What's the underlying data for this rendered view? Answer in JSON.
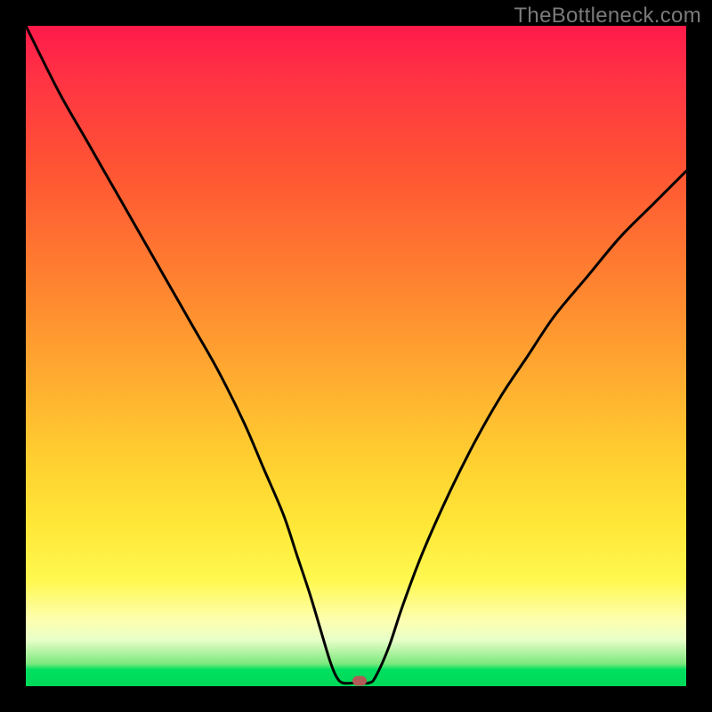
{
  "watermark": "TheBottleneck.com",
  "colors": {
    "frame": "#000000",
    "curve": "#000000",
    "marker": "#b25a55"
  },
  "chart_data": {
    "type": "line",
    "title": "",
    "xlabel": "",
    "ylabel": "",
    "xlim": [
      0,
      100
    ],
    "ylim": [
      0,
      100
    ],
    "grid": false,
    "watermark": "TheBottleneck.com",
    "series": [
      {
        "name": "bottleneck-curve",
        "x": [
          0,
          5,
          9,
          13,
          17,
          21,
          25,
          29,
          33,
          36,
          39,
          41,
          43,
          44.5,
          46,
          47,
          48,
          50,
          52,
          53,
          55,
          57,
          60,
          64,
          68,
          72,
          76,
          80,
          85,
          90,
          95,
          100
        ],
        "y": [
          100,
          90,
          83,
          76,
          69,
          62,
          55,
          48,
          40,
          33,
          26,
          20,
          14,
          9,
          4,
          1.5,
          0.5,
          0.5,
          0.5,
          1.5,
          6,
          12,
          20,
          29,
          37,
          44,
          50,
          56,
          62,
          68,
          73,
          78
        ]
      }
    ],
    "marker": {
      "x": 50.5,
      "y": 0.8
    },
    "background_gradient": [
      {
        "pos": 0,
        "color": "#ff1a4a"
      },
      {
        "pos": 0.35,
        "color": "#ff7a30"
      },
      {
        "pos": 0.7,
        "color": "#ffde33"
      },
      {
        "pos": 0.9,
        "color": "#fdffb0"
      },
      {
        "pos": 0.97,
        "color": "#00e060"
      },
      {
        "pos": 1.0,
        "color": "#00d858"
      }
    ]
  }
}
